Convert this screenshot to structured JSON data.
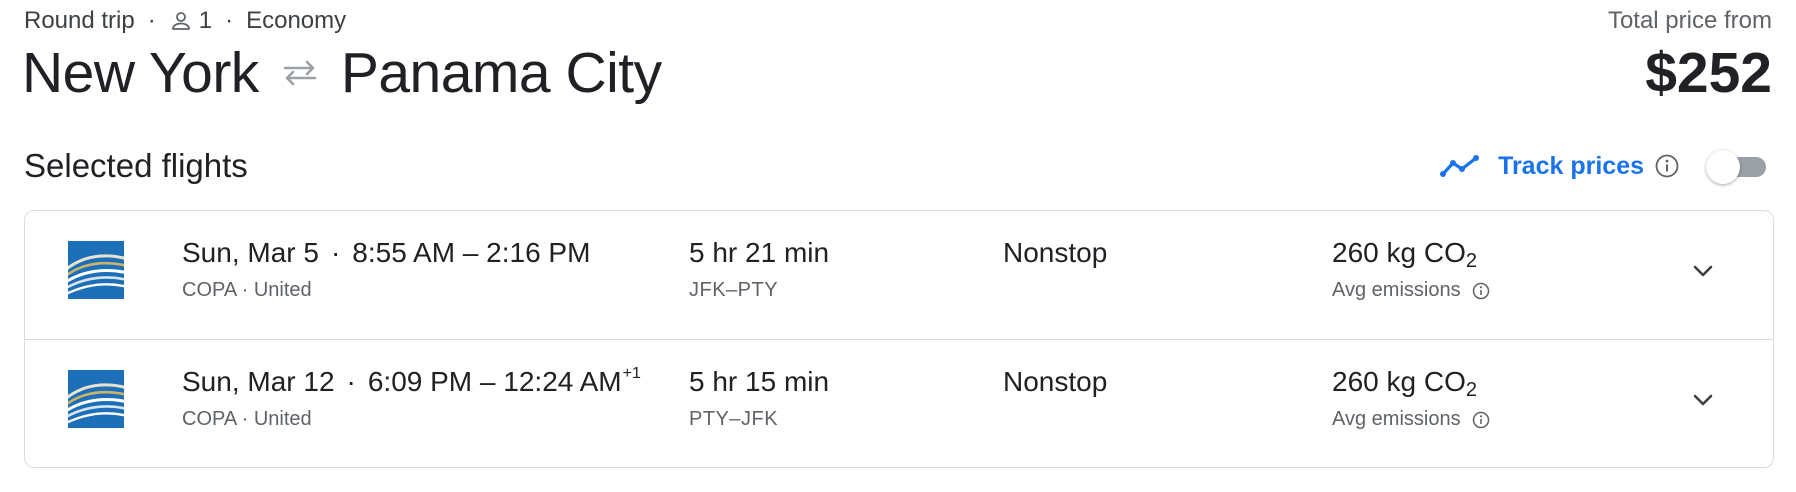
{
  "header": {
    "trip_type": "Round trip",
    "passenger_count": "1",
    "cabin_class": "Economy",
    "origin": "New York",
    "destination": "Panama City",
    "price_label": "Total price from",
    "price": "$252"
  },
  "section": {
    "title": "Selected flights",
    "track_prices_label": "Track prices",
    "track_prices_enabled": false
  },
  "icons": {
    "passenger": "person-icon",
    "route_swap": "swap-arrows-icon",
    "track": "trending-line-icon",
    "info": "info-icon",
    "expand": "chevron-down-icon",
    "airline_logo": "copa-airlines-logo"
  },
  "colors": {
    "accent": "#1a73e8",
    "text_primary": "#202124",
    "text_secondary": "#5f6368",
    "border": "#dadce0",
    "copa_blue": "#1d6fb8"
  },
  "flights": [
    {
      "date": "Sun, Mar 5",
      "depart": "8:55 AM",
      "arrive": "2:16 PM",
      "day_offset": "",
      "airlines": "COPA · United",
      "duration": "5 hr 21 min",
      "route": "JFK–PTY",
      "stops": "Nonstop",
      "emissions_value": "260 kg CO",
      "emissions_sub": "2",
      "emissions_label": "Avg emissions"
    },
    {
      "date": "Sun, Mar 12",
      "depart": "6:09 PM",
      "arrive": "12:24 AM",
      "day_offset": "+1",
      "airlines": "COPA · United",
      "duration": "5 hr 15 min",
      "route": "PTY–JFK",
      "stops": "Nonstop",
      "emissions_value": "260 kg CO",
      "emissions_sub": "2",
      "emissions_label": "Avg emissions"
    }
  ]
}
